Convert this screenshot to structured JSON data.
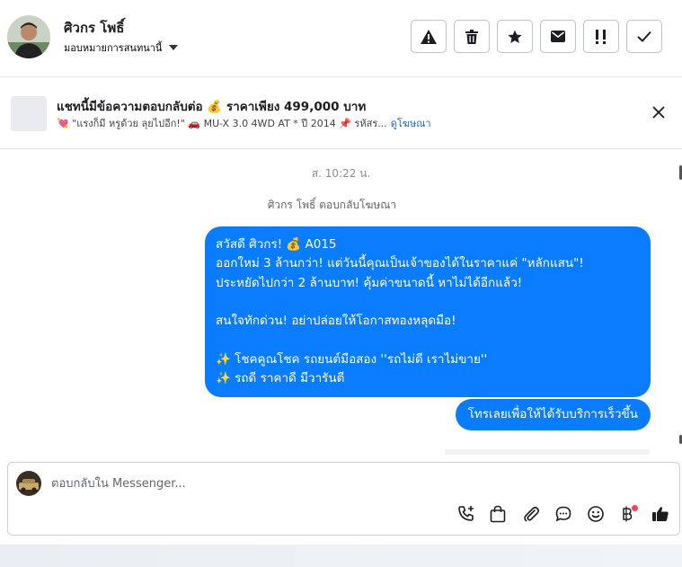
{
  "header": {
    "contact_name": "ศิวกร โพธิ์",
    "assign_label": "มอบหมายการสนทนานี้",
    "actions": [
      "spam-icon",
      "trash-icon",
      "star-icon",
      "mail-icon",
      "follow-up-icon",
      "check-icon"
    ]
  },
  "ad_banner": {
    "title": "แชทนี้มีข้อความตอบกลับต่อ 💰 ราคาเพียง 499,000 บาท",
    "subtitle": "💘 \"แรงก็มี หรูด้วย ลุยไปอีก!\" 🚗 MU-X 3.0 4WD AT * ปี 2014 📌 รหัสร...",
    "link": "ดูโฆษณา"
  },
  "chat": {
    "timestamp": "ส. 10:22 น.",
    "reply_note": "ศิวกร โพธิ์ ตอบกลับโฆษณา",
    "message_lines": [
      "สวัสดี ศิวกร! 💰 A015",
      "ออกใหม่ 3 ล้านกว่า! แต่วันนี้คุณเป็นเจ้าของได้ในราคาแค่ \"หลักแสน\"!",
      "ประหยัดไปกว่า 2 ล้านบาท! คุ้มค่าขนาดนี้ หาไม่ได้อีกแล้ว!",
      "",
      "สนใจทักด่วน! อย่าปล่อยให้โอกาสทองหลุดมือ!",
      "",
      "✨ โชคคูณโชค รถยนต์มือสอง ''รถไม่ดี เราไม่ขาย''",
      "✨ รถดี ราคาดี มีวารันตี"
    ],
    "quick_reply": "โทรเลยเพื่อให้ได้รับบริการเร็วขึ้น"
  },
  "composer": {
    "placeholder": "ตอบกลับใน Messenger...",
    "tools": [
      "phone-add-icon",
      "shopping-bag-icon",
      "attachment-icon",
      "saved-reply-icon",
      "emoji-icon",
      "baht-icon",
      "thumbs-up-icon"
    ]
  },
  "colors": {
    "bubble": "#0a7cff",
    "link": "#1d63c8",
    "border": "#bec3c9"
  }
}
